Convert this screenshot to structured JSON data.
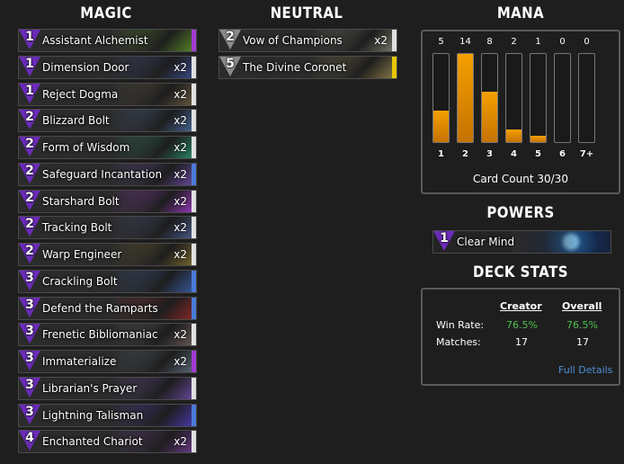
{
  "columns": {
    "magic": "MAGIC",
    "neutral": "NEUTRAL",
    "mana": "MANA",
    "powers": "POWERS",
    "deck_stats": "DECK STATS"
  },
  "magic_cards": [
    {
      "cost": "1",
      "name": "Assistant Alchemist",
      "count": "",
      "rarity": "#a23bd0",
      "art": "#5a8a2a"
    },
    {
      "cost": "1",
      "name": "Dimension Door",
      "count": "x2",
      "rarity": "#e0e0e0",
      "art": "#3a4a8a"
    },
    {
      "cost": "1",
      "name": "Reject Dogma",
      "count": "x2",
      "rarity": "#e0e0e0",
      "art": "#6a5a40"
    },
    {
      "cost": "2",
      "name": "Blizzard Bolt",
      "count": "x2",
      "rarity": "#e0e0e0",
      "art": "#4a6a9a"
    },
    {
      "cost": "2",
      "name": "Form of Wisdom",
      "count": "x2",
      "rarity": "#e0e0e0",
      "art": "#2a8a6a"
    },
    {
      "cost": "2",
      "name": "Safeguard Incantation",
      "count": "x2",
      "rarity": "#4a7ad8",
      "art": "#6a4aa0"
    },
    {
      "cost": "2",
      "name": "Starshard Bolt",
      "count": "x2",
      "rarity": "#e0e0e0",
      "art": "#9a3ac0"
    },
    {
      "cost": "2",
      "name": "Tracking Bolt",
      "count": "x2",
      "rarity": "#e0e0e0",
      "art": "#4a5a8a"
    },
    {
      "cost": "2",
      "name": "Warp Engineer",
      "count": "x2",
      "rarity": "#e0e0e0",
      "art": "#7a6a30"
    },
    {
      "cost": "3",
      "name": "Crackling Bolt",
      "count": "",
      "rarity": "#4a7ad8",
      "art": "#3a5aa0"
    },
    {
      "cost": "3",
      "name": "Defend the Ramparts",
      "count": "",
      "rarity": "#4a7ad8",
      "art": "#8a2a2a"
    },
    {
      "cost": "3",
      "name": "Frenetic Bibliomaniac",
      "count": "x2",
      "rarity": "#e0e0e0",
      "art": "#6a5a5a"
    },
    {
      "cost": "3",
      "name": "Immaterialize",
      "count": "x2",
      "rarity": "#a23bd0",
      "art": "#5a6a7a"
    },
    {
      "cost": "3",
      "name": "Librarian's Prayer",
      "count": "",
      "rarity": "#e0e0e0",
      "art": "#6a4aa0"
    },
    {
      "cost": "3",
      "name": "Lightning Talisman",
      "count": "",
      "rarity": "#4a7ad8",
      "art": "#4a3ab0"
    },
    {
      "cost": "4",
      "name": "Enchanted Chariot",
      "count": "x2",
      "rarity": "#e0e0e0",
      "art": "#6a3a8a"
    }
  ],
  "neutral_cards": [
    {
      "cost": "2",
      "name": "Vow of Champions",
      "count": "x2",
      "rarity": "#e0e0e0",
      "art": "#7a7a6a"
    },
    {
      "cost": "5",
      "name": "The Divine Coronet",
      "count": "",
      "rarity": "#e8c800",
      "art": "#8a7a4a"
    }
  ],
  "mana": {
    "counts": [
      "5",
      "14",
      "8",
      "2",
      "1",
      "0",
      "0"
    ],
    "values": [
      5,
      14,
      8,
      2,
      1,
      0,
      0
    ],
    "max": 14,
    "labels": [
      "1",
      "2",
      "3",
      "4",
      "5",
      "6",
      "7+"
    ],
    "card_count": "Card Count 30/30"
  },
  "power": {
    "cost": "1",
    "name": "Clear Mind"
  },
  "stats": {
    "creator_label": "Creator",
    "overall_label": "Overall",
    "win_rate_label": "Win Rate:",
    "matches_label": "Matches:",
    "creator_win": "76.5%",
    "overall_win": "76.5%",
    "creator_matches": "17",
    "overall_matches": "17",
    "details_link": "Full Details"
  },
  "colors": {
    "magic_gem": "#6a2bb8",
    "neutral_gem": "#8a8a8a",
    "bar_orange": "#f4a000",
    "win_green": "#4cc24c",
    "link_blue": "#4f8fd8"
  }
}
